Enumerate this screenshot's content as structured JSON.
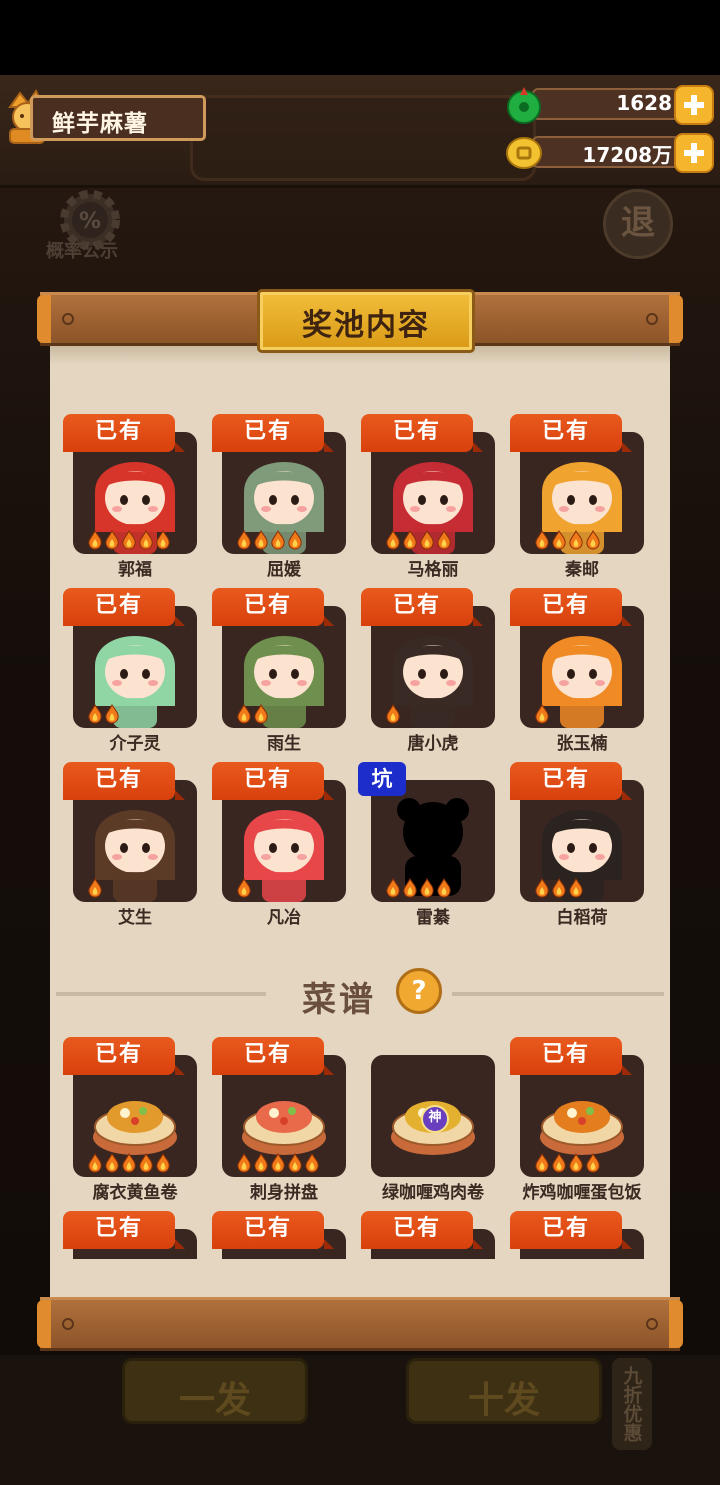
{
  "player": {
    "name": "鲜芋麻薯"
  },
  "resources": {
    "jade": {
      "value": "1628",
      "icon": "green-jade-icon"
    },
    "coins": {
      "value": "17208万",
      "icon": "gold-coin-icon"
    }
  },
  "background": {
    "probability_label": "概率公示",
    "exit_label": "退",
    "single_draw_label": "一发",
    "ten_draw_label": "十发",
    "discount_label": "九折优惠"
  },
  "pool": {
    "title": "奖池内容",
    "owned_label": "已有",
    "pit_label": "坑",
    "characters": [
      {
        "name": "郭福",
        "owned": true,
        "stars": 5,
        "color": "#d8352a"
      },
      {
        "name": "屈媛",
        "owned": true,
        "stars": 4,
        "color": "#7f9b7a"
      },
      {
        "name": "马格丽",
        "owned": true,
        "stars": 4,
        "color": "#c62c33"
      },
      {
        "name": "秦邮",
        "owned": true,
        "stars": 4,
        "color": "#f0a32e"
      },
      {
        "name": "介子灵",
        "owned": true,
        "stars": 2,
        "color": "#8fd6a4"
      },
      {
        "name": "雨生",
        "owned": true,
        "stars": 2,
        "color": "#6e8f4d"
      },
      {
        "name": "唐小虎",
        "owned": true,
        "stars": 1,
        "color": "#3a2a25"
      },
      {
        "name": "张玉楠",
        "owned": true,
        "stars": 1,
        "color": "#f08a25"
      },
      {
        "name": "艾生",
        "owned": true,
        "stars": 1,
        "color": "#5b3a26"
      },
      {
        "name": "凡冶",
        "owned": true,
        "stars": 1,
        "color": "#e8474a"
      },
      {
        "name": "雷綦",
        "owned": false,
        "stars": 4,
        "color": "#000000"
      },
      {
        "name": "白稻荷",
        "owned": true,
        "stars": 3,
        "color": "#2b2320"
      }
    ],
    "recipe_section": {
      "title": "菜谱",
      "help": "?"
    },
    "recipes": [
      {
        "name": "腐衣黄鱼卷",
        "owned": true,
        "stars": 5,
        "color": "#e39a2c"
      },
      {
        "name": "刺身拼盘",
        "owned": true,
        "stars": 5,
        "color": "#e86a4a"
      },
      {
        "name": "绿咖喱鸡肉卷",
        "owned": false,
        "stars": 0,
        "color": "#e4b030",
        "badge": "神"
      },
      {
        "name": "炸鸡咖喱蛋包饭",
        "owned": true,
        "stars": 4,
        "color": "#e37d1e"
      }
    ],
    "partial_row_owned": [
      "已有",
      "已有",
      "已有",
      "已有"
    ]
  }
}
